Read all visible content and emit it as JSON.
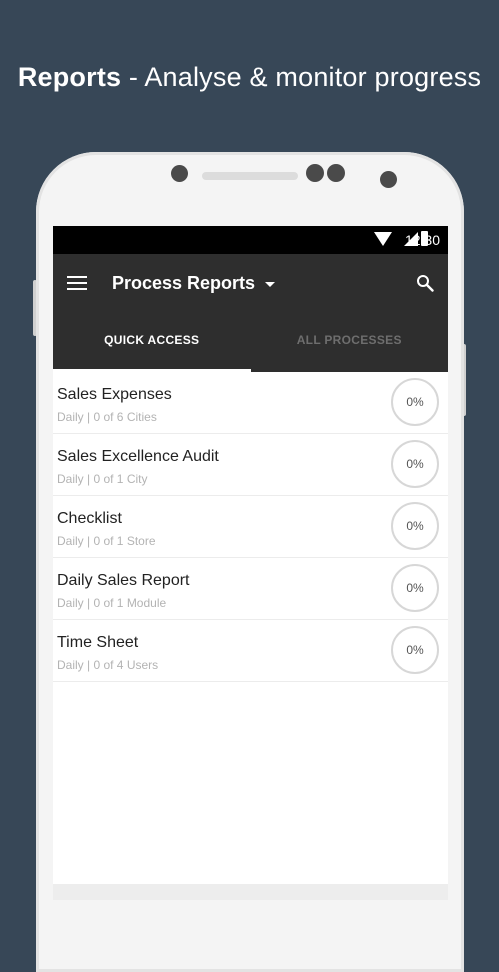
{
  "headline": {
    "bold": "Reports",
    "rest": " - Analyse & monitor progress"
  },
  "status_bar": {
    "time": "12:30"
  },
  "app_bar": {
    "title": "Process Reports"
  },
  "tabs": [
    {
      "label": "QUICK ACCESS",
      "active": true
    },
    {
      "label": "ALL PROCESSES",
      "active": false
    }
  ],
  "reports": [
    {
      "name": "Sales Expenses",
      "meta": "Daily | 0 of 6 Cities",
      "progress": "0%"
    },
    {
      "name": "Sales Excellence Audit",
      "meta": "Daily | 0 of 1 City",
      "progress": "0%"
    },
    {
      "name": "Checklist",
      "meta": "Daily | 0 of 1 Store",
      "progress": "0%"
    },
    {
      "name": "Daily Sales Report",
      "meta": "Daily | 0 of 1 Module",
      "progress": "0%"
    },
    {
      "name": "Time Sheet",
      "meta": "Daily | 0 of 4 Users",
      "progress": "0%"
    }
  ],
  "colors": {
    "background": "#374757",
    "app_bar": "#2e2e2e",
    "status_bar": "#000000"
  }
}
